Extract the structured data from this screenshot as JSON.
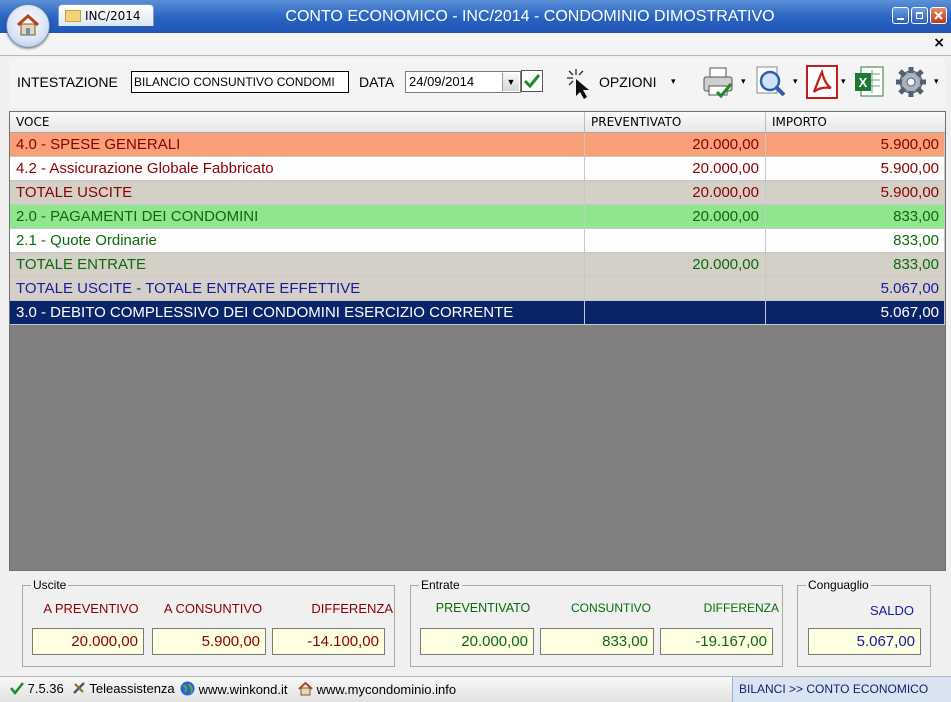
{
  "window": {
    "title": "CONTO ECONOMICO - INC/2014 - CONDOMINIO DIMOSTRATIVO",
    "doc_tab": "INC/2014",
    "close_glyph": "×"
  },
  "toolbar": {
    "intestazione_label": "INTESTAZIONE",
    "intestazione_value": "BILANCIO CONSUNTIVO CONDOMI",
    "data_label": "DATA",
    "data_value": "24/09/2014",
    "opzioni_label": "OPZIONI",
    "icons": [
      "home-icon",
      "folder-icon",
      "wand-icon",
      "printer-icon",
      "magnifier-icon",
      "pdf-icon",
      "excel-icon",
      "gear-icon"
    ]
  },
  "grid": {
    "headers": [
      "VOCE",
      "PREVENTIVATO",
      "IMPORTO"
    ],
    "rows": [
      {
        "voce": "4.0 - SPESE GENERALI",
        "preventivato": "20.000,00",
        "importo": "5.900,00",
        "bg": "#f8a178",
        "color": "#8b0000"
      },
      {
        "voce": "4.2 - Assicurazione Globale Fabbricato",
        "preventivato": "20.000,00",
        "importo": "5.900,00",
        "bg": "#ffffff",
        "color": "#8b0000"
      },
      {
        "voce": "TOTALE USCITE",
        "preventivato": "20.000,00",
        "importo": "5.900,00",
        "bg": "#d4d0c8",
        "color": "#8b0000"
      },
      {
        "voce": "2.0 - PAGAMENTI DEI CONDOMINI",
        "preventivato": "20.000,00",
        "importo": "833,00",
        "bg": "#8fe68f",
        "color": "#0a6a0a"
      },
      {
        "voce": "2.1 - Quote Ordinarie",
        "preventivato": "",
        "importo": "833,00",
        "bg": "#ffffff",
        "color": "#0a6a0a"
      },
      {
        "voce": "TOTALE ENTRATE",
        "preventivato": "20.000,00",
        "importo": "833,00",
        "bg": "#d4d0c8",
        "color": "#0a6a0a"
      },
      {
        "voce": "TOTALE USCITE - TOTALE ENTRATE EFFETTIVE",
        "preventivato": "",
        "importo": "5.067,00",
        "bg": "#d4d0c8",
        "color": "#1a1aa0"
      },
      {
        "voce": "3.0 - DEBITO COMPLESSIVO DEI CONDOMINI ESERCIZIO CORRENTE",
        "preventivato": "",
        "importo": "5.067,00",
        "bg": "#0a246a",
        "color": "#ffffff"
      }
    ]
  },
  "uscite": {
    "title": "Uscite",
    "labels": [
      "A PREVENTIVO",
      "A CONSUNTIVO",
      "DIFFERENZA"
    ],
    "values": [
      "20.000,00",
      "5.900,00",
      "-14.100,00"
    ],
    "color": "#8b0000"
  },
  "entrate": {
    "title": "Entrate",
    "labels": [
      "PREVENTIVATO",
      "CONSUNTIVO",
      "DIFFERENZA"
    ],
    "values": [
      "20.000,00",
      "833,00",
      "-19.167,00"
    ],
    "color": "#0a6a0a"
  },
  "conguaglio": {
    "title": "Conguaglio",
    "label": "SALDO",
    "value": "5.067,00",
    "color": "#1a1aa0"
  },
  "status": {
    "version": "7.5.36",
    "teleassistenza": "Teleassistenza",
    "site1": "www.winkond.it",
    "site2": "www.mycondominio.info",
    "breadcrumb": "BILANCI >> CONTO ECONOMICO"
  }
}
